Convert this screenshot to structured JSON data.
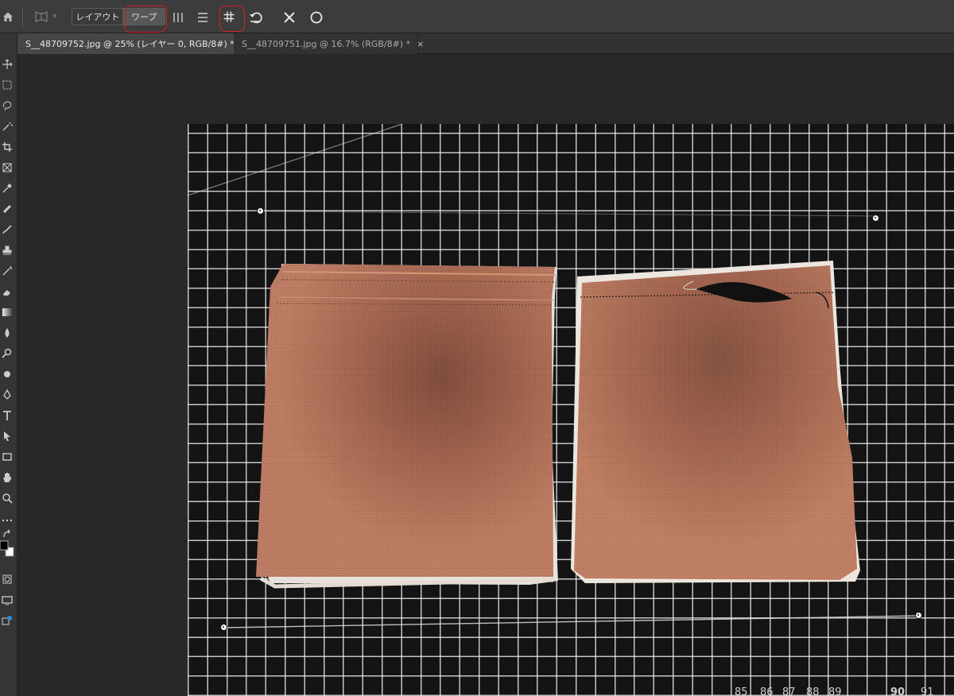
{
  "options_bar": {
    "mode_layout_label": "レイアウト",
    "mode_warp_label": "ワープ",
    "home_icon": "home-icon",
    "warp_tool_icon": "warp-tool-icon",
    "split_vertical_icon": "split-vertical-icon",
    "split_horizontal_icon": "split-horizontal-icon",
    "grid_icon": "grid-icon",
    "undo_icon": "reset-warp-icon",
    "cancel_icon": "cancel-icon",
    "commit_icon": "commit-icon",
    "annotation_color": "#d61f1f"
  },
  "tabs": [
    {
      "label": "S__48709752.jpg @ 25% (レイヤー 0, RGB/8#) *",
      "close": "×",
      "active": true
    },
    {
      "label": "S__48709751.jpg @ 16.7% (RGB/8#) *",
      "close": "×",
      "active": false
    }
  ],
  "toolbar": {
    "tools": [
      "move-tool-icon",
      "marquee-tool-icon",
      "lasso-tool-icon",
      "magic-wand-icon",
      "crop-tool-icon",
      "frame-tool-icon",
      "eyedropper-icon",
      "healing-brush-icon",
      "brush-tool-icon",
      "stamp-tool-icon",
      "history-brush-icon",
      "eraser-icon",
      "gradient-icon",
      "blur-icon",
      "dodge-icon",
      "pen-tool-icon",
      "type-tool-icon",
      "path-select-icon",
      "rectangle-tool-icon",
      "hand-tool-icon",
      "zoom-tool-icon",
      "more-tools-icon",
      "swap-colors-icon",
      "color-swatch-icon",
      "quickmask-icon",
      "screen-mode-icon",
      "share-icon"
    ]
  },
  "canvas": {
    "background_color": "#282828",
    "mat_color": "#141415",
    "mat_ruler_numbers": [
      "85",
      "86",
      "87",
      "88",
      "89",
      "90",
      "91"
    ],
    "fabric_color": "#b0705a"
  }
}
